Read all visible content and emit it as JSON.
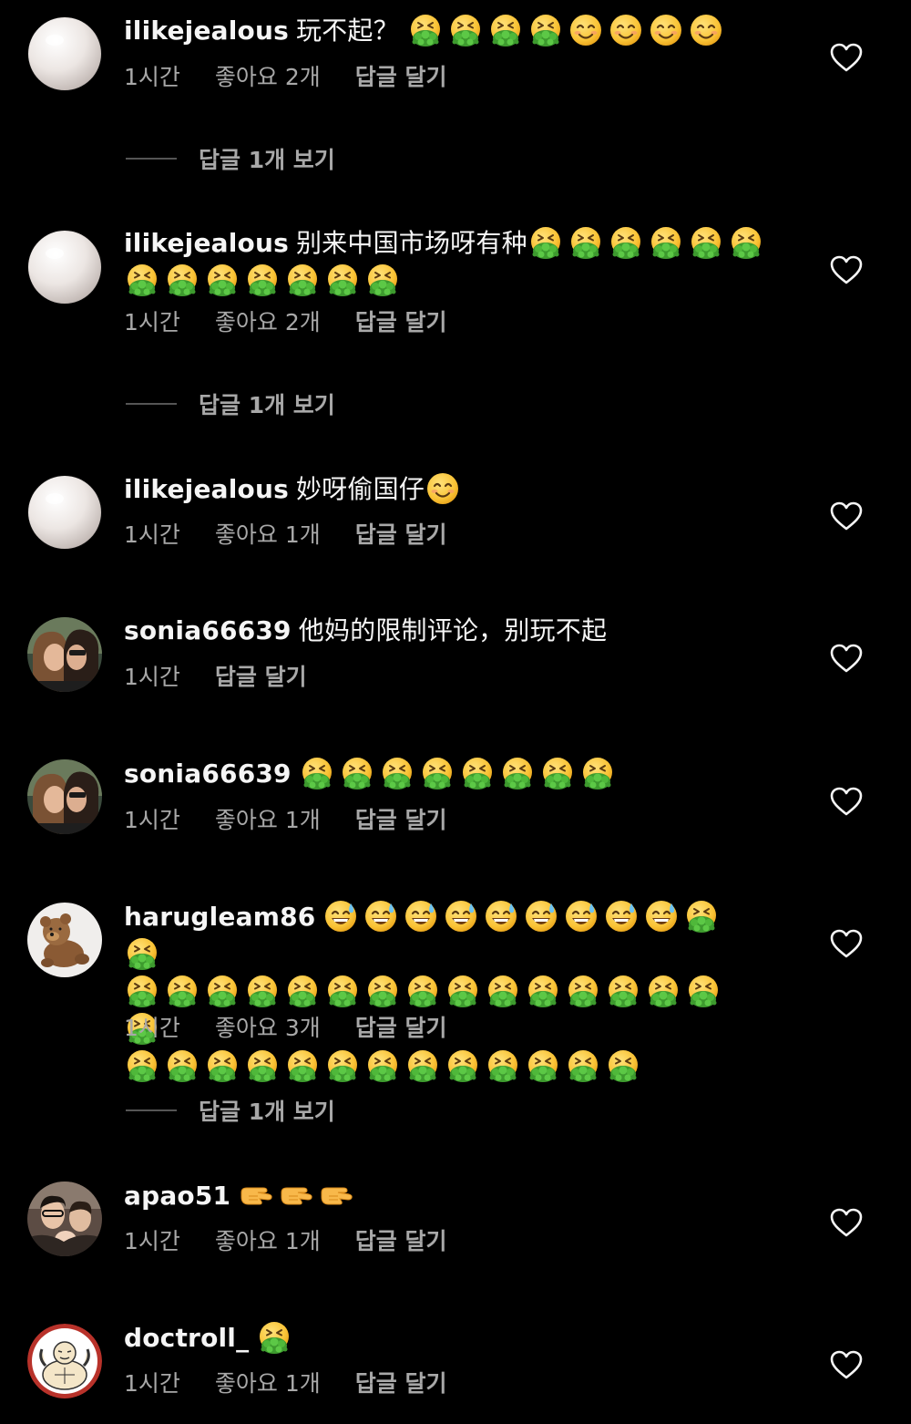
{
  "colors": {
    "background": "#000000",
    "primary_text": "#f5f5f5",
    "secondary_text": "#a8a8a8",
    "divider": "#555555"
  },
  "comments": [
    {
      "username": "ilikejealous",
      "text": "玩不起？",
      "emojis": [
        "vomiting-face",
        "vomiting-face",
        "vomiting-face",
        "vomiting-face",
        "smiling-face",
        "smiling-face",
        "smiling-face",
        "smiling-face"
      ],
      "time": "1시간",
      "likes": "좋아요 2개",
      "reply_label": "답글 달기",
      "view_replies": "답글 1개 보기",
      "avatar": "pearl-avatar"
    },
    {
      "username": "ilikejealous",
      "text": "别来中国市场呀有种",
      "emojis": [
        "vomiting-face",
        "vomiting-face",
        "vomiting-face",
        "vomiting-face",
        "vomiting-face",
        "vomiting-face",
        "vomiting-face",
        "vomiting-face",
        "vomiting-face",
        "vomiting-face",
        "vomiting-face",
        "vomiting-face",
        "vomiting-face"
      ],
      "time": "1시간",
      "likes": "좋아요 2개",
      "reply_label": "답글 달기",
      "view_replies": "답글 1개 보기",
      "avatar": "pearl-avatar"
    },
    {
      "username": "ilikejealous",
      "text": "妙呀偷国仔",
      "emojis": [
        "smiling-face"
      ],
      "time": "1시간",
      "likes": "좋아요 1개",
      "reply_label": "답글 달기",
      "view_replies": "",
      "avatar": "pearl-avatar"
    },
    {
      "username": "sonia66639",
      "text": "他妈的限制评论，别玩不起",
      "emojis": [],
      "time": "1시간",
      "likes": "",
      "reply_label": "답글 달기",
      "view_replies": "",
      "avatar": "couple-photo-avatar"
    },
    {
      "username": "sonia66639",
      "text": "",
      "emojis": [
        "vomiting-face",
        "vomiting-face",
        "vomiting-face",
        "vomiting-face",
        "vomiting-face",
        "vomiting-face",
        "vomiting-face",
        "vomiting-face"
      ],
      "time": "1시간",
      "likes": "좋아요 1개",
      "reply_label": "답글 달기",
      "view_replies": "",
      "avatar": "couple-photo-avatar"
    },
    {
      "username": "harugleam86",
      "text": "",
      "emojis": [
        "grinning-sweat-face",
        "grinning-sweat-face",
        "grinning-sweat-face",
        "grinning-sweat-face",
        "grinning-sweat-face",
        "grinning-sweat-face",
        "grinning-sweat-face",
        "grinning-sweat-face",
        "grinning-sweat-face",
        "vomiting-face",
        "vomiting-face",
        "vomiting-face",
        "vomiting-face",
        "vomiting-face",
        "vomiting-face",
        "vomiting-face",
        "vomiting-face",
        "vomiting-face",
        "vomiting-face",
        "vomiting-face",
        "vomiting-face",
        "vomiting-face",
        "vomiting-face",
        "vomiting-face",
        "vomiting-face",
        "vomiting-face",
        "vomiting-face",
        "vomiting-face",
        "vomiting-face",
        "vomiting-face",
        "vomiting-face",
        "vomiting-face",
        "vomiting-face",
        "vomiting-face",
        "vomiting-face",
        "vomiting-face",
        "vomiting-face",
        "vomiting-face",
        "vomiting-face"
      ],
      "time": "1시간",
      "likes": "좋아요 3개",
      "reply_label": "답글 달기",
      "view_replies": "답글 1개 보기",
      "avatar": "teddy-bear-avatar"
    },
    {
      "username": "apao51",
      "text": "",
      "emojis": [
        "pointing-hand",
        "pointing-hand",
        "pointing-hand"
      ],
      "time": "1시간",
      "likes": "좋아요 1개",
      "reply_label": "답글 달기",
      "view_replies": "",
      "avatar": "group-photo-avatar"
    },
    {
      "username": "doctroll_",
      "text": "",
      "emojis": [
        "vomiting-face"
      ],
      "time": "1시간",
      "likes": "좋아요 1개",
      "reply_label": "답글 달기",
      "view_replies": "",
      "avatar": "cartoon-avatar"
    }
  ]
}
